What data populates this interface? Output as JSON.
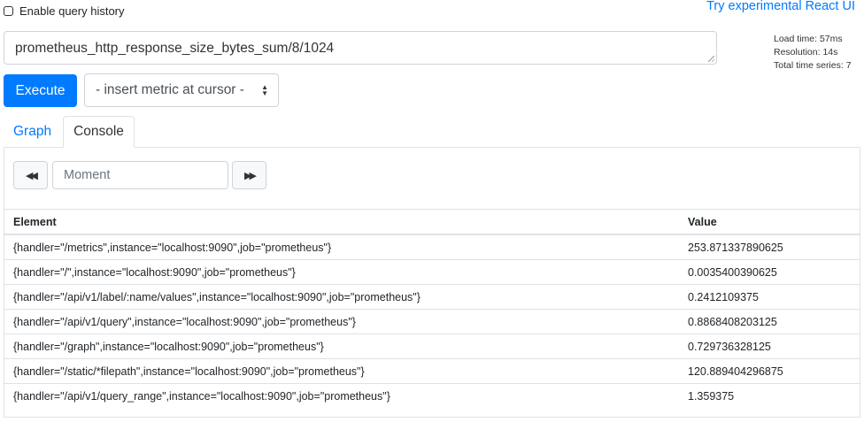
{
  "header": {
    "query_history_label": "Enable query history",
    "query_history_checked": false,
    "react_link": "Try experimental React UI"
  },
  "query": {
    "expression": "prometheus_http_response_size_bytes_sum/8/1024"
  },
  "stats": {
    "load_time": "Load time: 57ms",
    "resolution": "Resolution: 14s",
    "total_series": "Total time series: 7"
  },
  "controls": {
    "execute_label": "Execute",
    "metric_select": "- insert metric at cursor -"
  },
  "tabs": {
    "graph": "Graph",
    "console": "Console",
    "active": "console"
  },
  "console": {
    "back_icon": "fast-backward-icon",
    "forward_icon": "fast-forward-icon",
    "moment_placeholder": "Moment",
    "columns": [
      "Element",
      "Value"
    ],
    "rows": [
      {
        "element": "{handler=\"/metrics\",instance=\"localhost:9090\",job=\"prometheus\"}",
        "value": "253.871337890625"
      },
      {
        "element": "{handler=\"/\",instance=\"localhost:9090\",job=\"prometheus\"}",
        "value": "0.0035400390625"
      },
      {
        "element": "{handler=\"/api/v1/label/:name/values\",instance=\"localhost:9090\",job=\"prometheus\"}",
        "value": "0.2412109375"
      },
      {
        "element": "{handler=\"/api/v1/query\",instance=\"localhost:9090\",job=\"prometheus\"}",
        "value": "0.8868408203125"
      },
      {
        "element": "{handler=\"/graph\",instance=\"localhost:9090\",job=\"prometheus\"}",
        "value": "0.729736328125"
      },
      {
        "element": "{handler=\"/static/*filepath\",instance=\"localhost:9090\",job=\"prometheus\"}",
        "value": "120.889404296875"
      },
      {
        "element": "{handler=\"/api/v1/query_range\",instance=\"localhost:9090\",job=\"prometheus\"}",
        "value": "1.359375"
      }
    ]
  },
  "colors": {
    "primary": "#007bff",
    "border": "#dee2e6"
  }
}
